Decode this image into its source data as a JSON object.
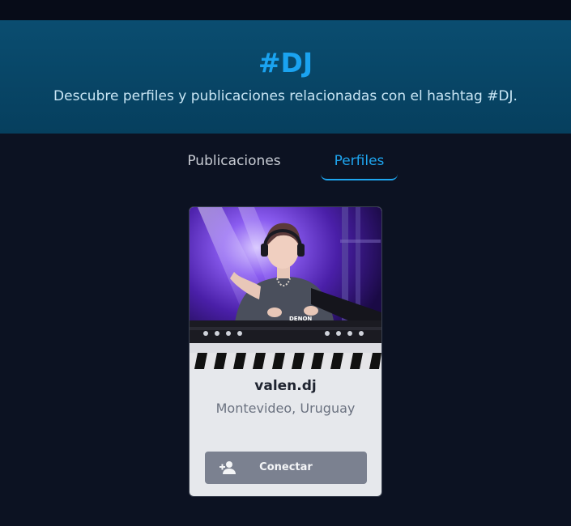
{
  "hero": {
    "title": "#DJ",
    "subtitle": "Descubre perfiles y publicaciones relacionadas con el hashtag #DJ."
  },
  "tabs": [
    {
      "label": "Publicaciones",
      "active": false
    },
    {
      "label": "Perfiles",
      "active": true
    }
  ],
  "profile_card": {
    "username": "valen.dj",
    "location": "Montevideo, Uruguay",
    "photo_icon": "dj-photo",
    "photo_brand_text": "DENON",
    "connect_button": {
      "label": "Conectar",
      "icon": "add-user-icon"
    }
  },
  "colors": {
    "background": "#0c1222",
    "hero_background": "#0a4d70",
    "accent": "#1ea5ef",
    "card_background": "#e6e8ec",
    "button_background": "#7b8190"
  }
}
